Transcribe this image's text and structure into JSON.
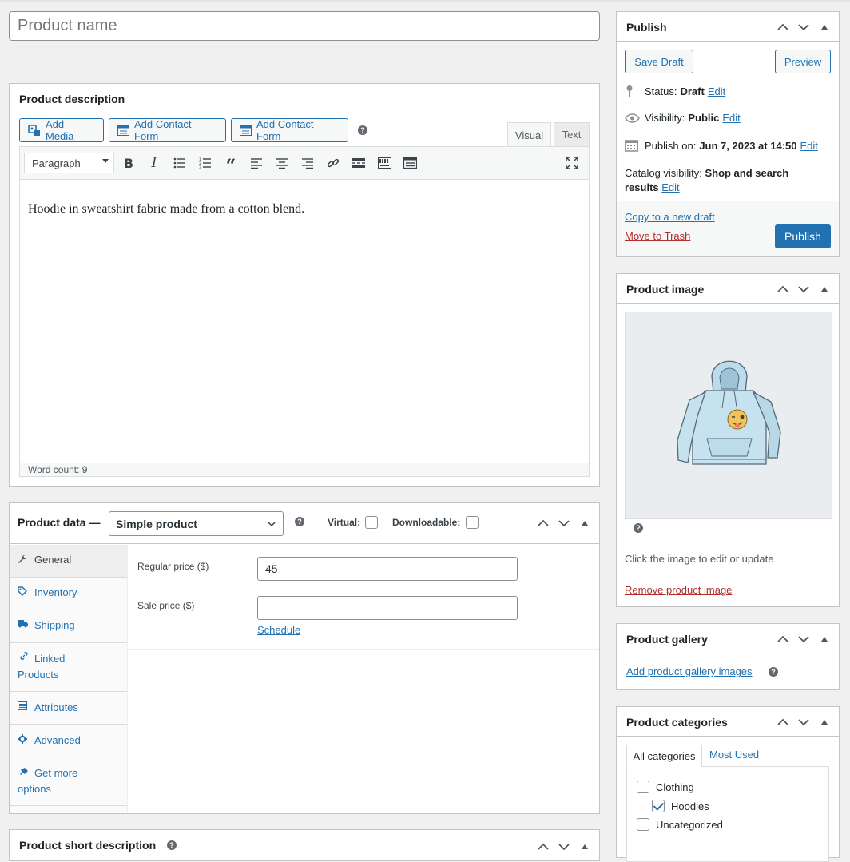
{
  "product_name": {
    "placeholder": "Product name"
  },
  "description": {
    "title": "Product description",
    "add_media": "Add Media",
    "add_contact_form_1": "Add Contact Form",
    "add_contact_form_2": "Add Contact Form",
    "tab_visual": "Visual",
    "tab_text": "Text",
    "format_select": "Paragraph",
    "content": "Hoodie in sweatshirt fabric made from a cotton blend.",
    "word_count": "Word count: 9"
  },
  "product_data": {
    "title": "Product data —",
    "type_select": "Simple product",
    "virtual_label": "Virtual:",
    "downloadable_label": "Downloadable:",
    "tabs": [
      {
        "label": "General",
        "icon": "wrench-icon"
      },
      {
        "label": "Inventory",
        "icon": "tag-icon"
      },
      {
        "label": "Shipping",
        "icon": "truck-icon"
      },
      {
        "label": "Linked Products",
        "icon": "link-icon"
      },
      {
        "label": "Attributes",
        "icon": "list-icon"
      },
      {
        "label": "Advanced",
        "icon": "gear-icon"
      },
      {
        "label": "Get more options",
        "icon": "plugin-icon"
      }
    ],
    "regular_price_label": "Regular price ($)",
    "regular_price_value": "45",
    "sale_price_label": "Sale price ($)",
    "sale_price_value": "",
    "schedule_link": "Schedule"
  },
  "short_description": {
    "title": "Product short description"
  },
  "publish": {
    "title": "Publish",
    "save_draft": "Save Draft",
    "preview": "Preview",
    "status_label": "Status:",
    "status_value": "Draft",
    "visibility_label": "Visibility:",
    "visibility_value": "Public",
    "publish_on_label": "Publish on:",
    "publish_on_value": "Jun 7, 2023 at 14:50",
    "catalog_label": "Catalog visibility:",
    "catalog_value_1": "Shop and search",
    "catalog_value_2": "results",
    "edit": "Edit",
    "copy_draft": "Copy to a new draft",
    "move_trash": "Move to Trash",
    "publish_button": "Publish"
  },
  "product_image": {
    "title": "Product image",
    "hint": "Click the image to edit or update",
    "remove": "Remove product image"
  },
  "product_gallery": {
    "title": "Product gallery",
    "add": "Add product gallery images"
  },
  "product_categories": {
    "title": "Product categories",
    "tab_all": "All categories",
    "tab_most_used": "Most Used",
    "items": [
      {
        "label": "Clothing",
        "checked": false,
        "indent": 0
      },
      {
        "label": "Hoodies",
        "checked": true,
        "indent": 1
      },
      {
        "label": "Uncategorized",
        "checked": false,
        "indent": 0
      }
    ]
  },
  "colors": {
    "accent": "#2271b1",
    "danger": "#b32d2e",
    "border": "#c3c4c7",
    "background": "#f0f0f1"
  }
}
